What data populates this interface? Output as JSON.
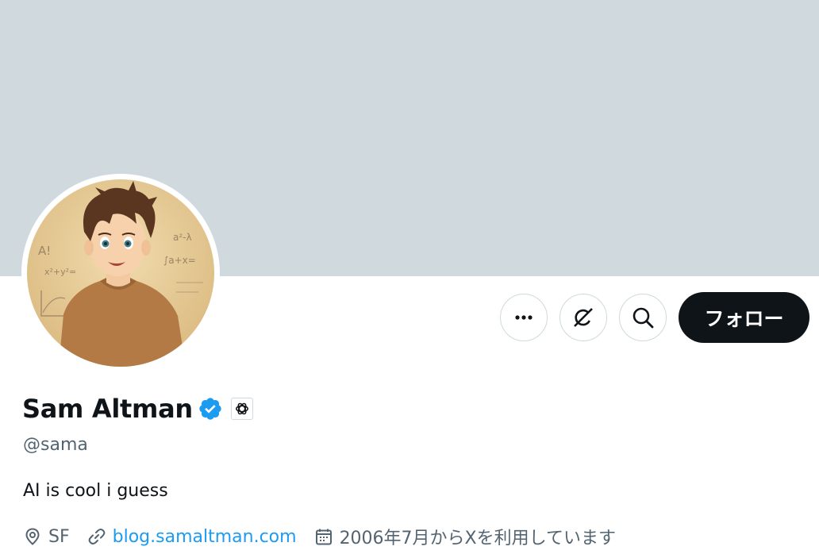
{
  "profile": {
    "display_name": "Sam Altman",
    "handle": "@sama",
    "bio": "AI is cool i guess",
    "location": "SF",
    "website": "blog.samaltman.com",
    "joined": "2006年7月からXを利用しています"
  },
  "actions": {
    "more_icon": "more-icon",
    "grok_icon": "grok-icon",
    "search_icon": "search-icon",
    "follow_label": "フォロー"
  },
  "avatar": {
    "chalkboard_text": [
      "A!",
      "x²+y²=",
      "a²-λ",
      "∫a+x="
    ]
  },
  "colors": {
    "banner": "#cfd9de",
    "primary_text": "#0f1419",
    "secondary_text": "#536471",
    "link": "#1d9bf0",
    "verified": "#1d9bf0",
    "follow_bg": "#0f1419"
  }
}
